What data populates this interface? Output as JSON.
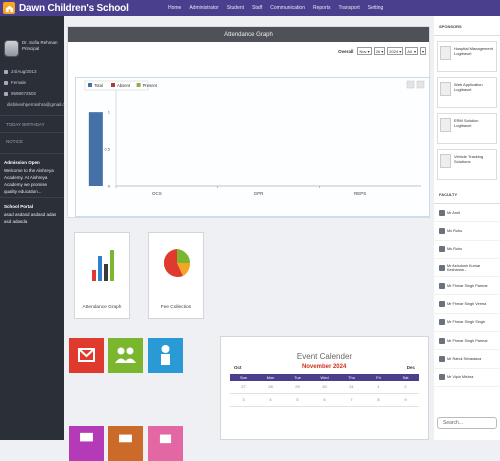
{
  "app": {
    "title": "Dawn Children's School"
  },
  "nav": [
    "Home",
    "Administrator",
    "Student",
    "Staff",
    "Communication",
    "Reports",
    "Transport",
    "Setting"
  ],
  "profile": {
    "name": "Dr. Sofia Rehman",
    "role": "Principal",
    "dob": "24/Aug/2013",
    "gender": "Female",
    "phone": "9598072502",
    "email": "dishikeshpermishra@gmail.c..."
  },
  "sidebar": {
    "today_birthday": "TODAY BIRTHDAY",
    "notice": "NOTICE",
    "admission_title": "Admission Open",
    "admission_text": "Welcome to the Aishreya Academy. At Aishreya Academy we promise quality education...",
    "portal_title": "School Portal",
    "portal_text": "asad asdasd asdasd adas asd adasda"
  },
  "graph": {
    "title": "Attendance Graph",
    "filter_label": "Overall",
    "month": "Nov",
    "day": "26",
    "year": "2024",
    "scope": "All"
  },
  "chart_data": {
    "type": "bar",
    "categories": [
      "OCS",
      "GPR",
      "REPS"
    ],
    "series": [
      {
        "name": "Total",
        "values": [
          1,
          0,
          0
        ],
        "color": "#4472a8"
      },
      {
        "name": "Absent",
        "values": [
          0,
          0,
          0
        ],
        "color": "#b33a3a"
      },
      {
        "name": "Present",
        "values": [
          0,
          0,
          0
        ],
        "color": "#8db04a"
      }
    ],
    "yticks": [
      "0",
      "0.5",
      "1"
    ],
    "ylim": [
      0,
      1.3
    ]
  },
  "tiles": [
    {
      "label": "Attendance Graph"
    },
    {
      "label": "Fee Collection"
    }
  ],
  "apps": [
    {
      "icon": "envelope-icon",
      "color": "#e03a2e"
    },
    {
      "icon": "users-icon",
      "color": "#7bb62f"
    },
    {
      "icon": "person-icon",
      "color": "#2a9ad6"
    },
    {
      "icon": "board-icon",
      "color": "#b43ab7"
    },
    {
      "icon": "bus-icon",
      "color": "#cc6a2a"
    },
    {
      "icon": "calendar-icon",
      "color": "#e267a3"
    }
  ],
  "calendar": {
    "title": "Event Calender",
    "month": "November 2024",
    "prev": "Oct",
    "next": "Dec",
    "dow": [
      "Sun",
      "Mon",
      "Tue",
      "Wed",
      "Thu",
      "Fri",
      "Sat"
    ],
    "row1": [
      "27",
      "28",
      "29",
      "30",
      "31",
      "1",
      "2"
    ],
    "row2": [
      "3",
      "4",
      "5",
      "6",
      "7",
      "8",
      "9"
    ]
  },
  "sponsors": {
    "title": "SPONSORS",
    "items": [
      {
        "name": "Hospital Management",
        "by": "Logitravel"
      },
      {
        "name": "Web Application",
        "by": "Logitravel"
      },
      {
        "name": "ERM Solution",
        "by": "Logitravel"
      },
      {
        "name": "Vehicle Tracking Solutions",
        "by": ""
      }
    ]
  },
  "faculty": {
    "title": "FACULTY",
    "items": [
      "Mr Amit",
      "Ms Ruhu",
      "Ms Ruhu",
      "Mr Ashutosh Kumar Kesharwa...",
      "Mr Fhmar Singh Parmar",
      "Mr Fhmar Singh Verma",
      "Mr Fhmar Singh Singh",
      "Mr Fhmar Singh Parmar",
      "Mr Rahul Srivastava",
      "Mr Vipin Mishra"
    ]
  },
  "search": {
    "placeholder": "Search..."
  }
}
